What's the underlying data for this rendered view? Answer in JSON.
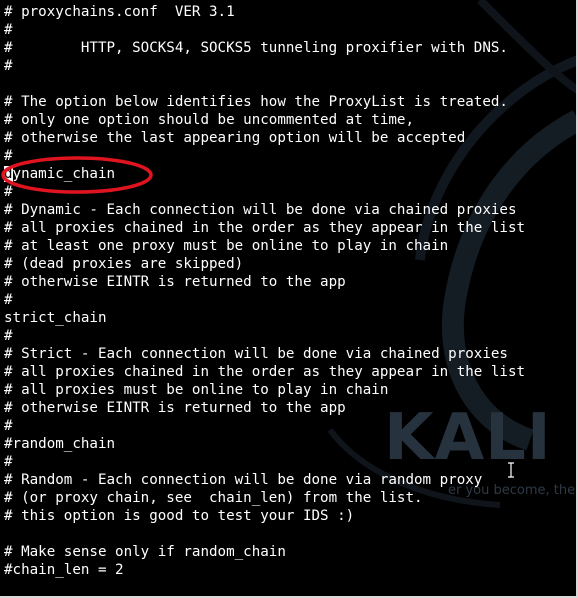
{
  "file": {
    "lines": [
      "# proxychains.conf  VER 3.1",
      "#",
      "#        HTTP, SOCKS4, SOCKS5 tunneling proxifier with DNS.",
      "#",
      "",
      "# The option below identifies how the ProxyList is treated.",
      "# only one option should be uncommented at time,",
      "# otherwise the last appearing option will be accepted",
      "#",
      "dynamic_chain",
      "#",
      "# Dynamic - Each connection will be done via chained proxies",
      "# all proxies chained in the order as they appear in the list",
      "# at least one proxy must be online to play in chain",
      "# (dead proxies are skipped)",
      "# otherwise EINTR is returned to the app",
      "#",
      "strict_chain",
      "#",
      "# Strict - Each connection will be done via chained proxies",
      "# all proxies chained in the order as they appear in the list",
      "# all proxies must be online to play in chain",
      "# otherwise EINTR is returned to the app",
      "#",
      "#random_chain",
      "#",
      "# Random - Each connection will be done via random proxy",
      "# (or proxy chain, see  chain_len) from the list.",
      "# this option is good to test your IDS :)",
      "",
      "# Make sense only if random_chain",
      "#chain_len = 2"
    ],
    "cursor": {
      "line": 9,
      "column": 0
    }
  },
  "wallpaper": {
    "logo_text": "KALI LI",
    "tagline_text": "er you become, the m"
  },
  "colors": {
    "background": "#000000",
    "text": "#ffffff",
    "annotation": "#e0141e",
    "wallpaper_text": "#26323e"
  }
}
